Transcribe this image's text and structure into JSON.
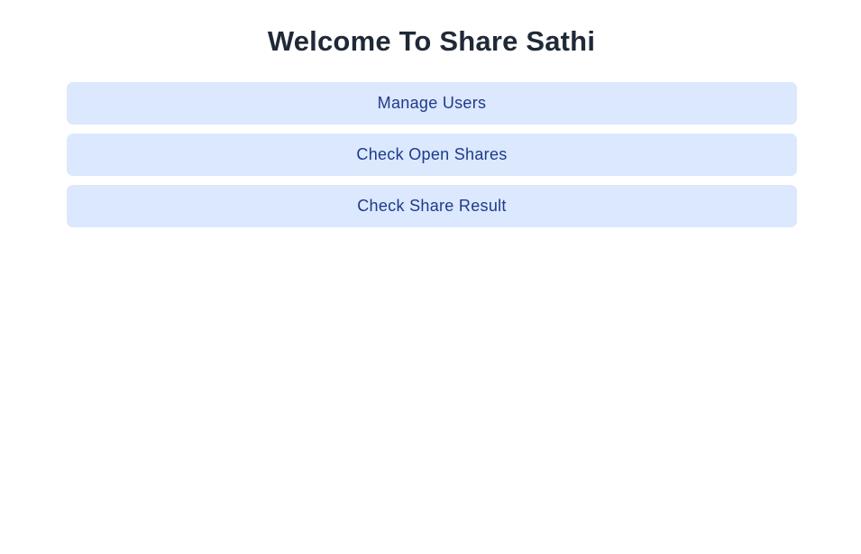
{
  "header": {
    "title": "Welcome To Share Sathi"
  },
  "menu": {
    "items": [
      {
        "label": "Manage Users"
      },
      {
        "label": "Check Open Shares"
      },
      {
        "label": "Check Share Result"
      }
    ]
  },
  "colors": {
    "title_text": "#1f2937",
    "button_background": "#dbe8fe",
    "button_text": "#1e3a8a",
    "page_background": "#ffffff"
  }
}
